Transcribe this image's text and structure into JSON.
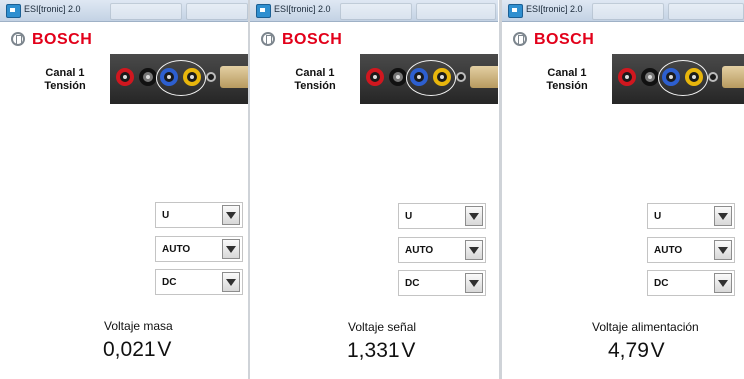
{
  "panels": [
    {
      "window_title": "ESI[tronic] 2.0",
      "brand": "BOSCH",
      "channel": {
        "line1": "Canal 1",
        "line2": "Tensión"
      },
      "selectors": {
        "quantity": "U",
        "range": "AUTO",
        "coupling": "DC"
      },
      "measurement": {
        "label": "Voltaje masa",
        "value": "0,021",
        "unit": "V"
      }
    },
    {
      "window_title": "ESI[tronic] 2.0",
      "brand": "BOSCH",
      "channel": {
        "line1": "Canal 1",
        "line2": "Tensión"
      },
      "selectors": {
        "quantity": "U",
        "range": "AUTO",
        "coupling": "DC"
      },
      "measurement": {
        "label": "Voltaje señal",
        "value": "1,331",
        "unit": "V"
      }
    },
    {
      "window_title": "ESI[tronic] 2.0",
      "brand": "BOSCH",
      "channel": {
        "line1": "Canal 1",
        "line2": "Tensión"
      },
      "selectors": {
        "quantity": "U",
        "range": "AUTO",
        "coupling": "DC"
      },
      "measurement": {
        "label": "Voltaje alimentación",
        "value": "4,79",
        "unit": "V"
      }
    }
  ],
  "colors": {
    "brand_red": "#e2001a",
    "titlebar": "#c3d2e4"
  }
}
